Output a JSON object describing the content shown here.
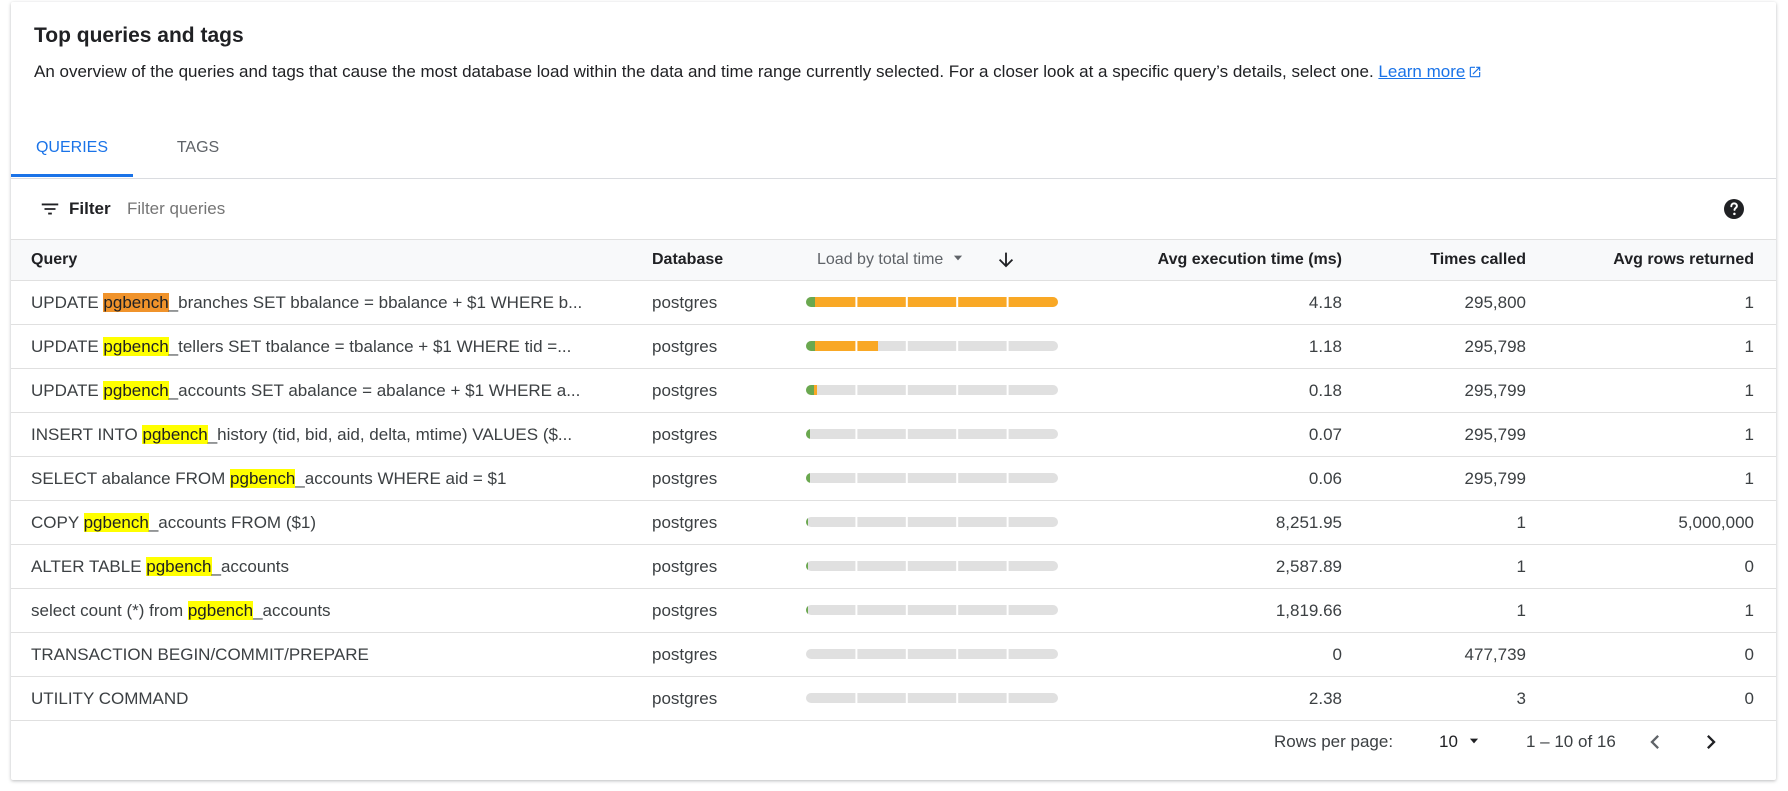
{
  "header": {
    "title": "Top queries and tags",
    "description": "An overview of the queries and tags that cause the most database load within the data and time range currently selected. For a closer look at a specific query’s details, select one.",
    "learn_more": "Learn more"
  },
  "tabs": [
    {
      "label": "QUERIES",
      "active": true
    },
    {
      "label": "TAGS",
      "active": false
    }
  ],
  "filter": {
    "label": "Filter",
    "placeholder": "Filter queries",
    "value": ""
  },
  "columns": {
    "query": "Query",
    "database": "Database",
    "load": "Load by total time",
    "avg_exec": "Avg execution time (ms)",
    "times_called": "Times called",
    "avg_rows": "Avg rows returned"
  },
  "colors": {
    "accent": "#1a73e8",
    "load_green": "#6aa84f",
    "load_orange": "#f9a825",
    "bar_track": "#e0e0e0",
    "highlight_yellow": "#ffff00",
    "highlight_orange": "#f0932b"
  },
  "rows": [
    {
      "pre": "UPDATE ",
      "hl": "pgbench",
      "post": "_branches SET bbalance = bbalance + $1 WHERE b...",
      "hl_style": "orange",
      "database": "postgres",
      "load_green": 0.035,
      "load_orange": 0.965,
      "avg_exec": "4.18",
      "times_called": "295,800",
      "avg_rows": "1"
    },
    {
      "pre": "UPDATE ",
      "hl": "pgbench",
      "post": "_tellers SET tbalance = tbalance + $1 WHERE tid =...",
      "hl_style": "yellow",
      "database": "postgres",
      "load_green": 0.035,
      "load_orange": 0.25,
      "avg_exec": "1.18",
      "times_called": "295,798",
      "avg_rows": "1"
    },
    {
      "pre": "UPDATE ",
      "hl": "pgbench",
      "post": "_accounts SET abalance = abalance + $1 WHERE a...",
      "hl_style": "yellow",
      "database": "postgres",
      "load_green": 0.03,
      "load_orange": 0.012,
      "avg_exec": "0.18",
      "times_called": "295,799",
      "avg_rows": "1"
    },
    {
      "pre": "INSERT INTO ",
      "hl": "pgbench",
      "post": "_history (tid, bid, aid, delta, mtime) VALUES ($...",
      "hl_style": "yellow",
      "database": "postgres",
      "load_green": 0.015,
      "load_orange": 0.0,
      "avg_exec": "0.07",
      "times_called": "295,799",
      "avg_rows": "1"
    },
    {
      "pre": "SELECT abalance FROM ",
      "hl": "pgbench",
      "post": "_accounts WHERE aid = $1",
      "hl_style": "yellow",
      "database": "postgres",
      "load_green": 0.015,
      "load_orange": 0.0,
      "avg_exec": "0.06",
      "times_called": "295,799",
      "avg_rows": "1"
    },
    {
      "pre": "COPY ",
      "hl": "pgbench",
      "post": "_accounts FROM ($1)",
      "hl_style": "yellow",
      "database": "postgres",
      "load_green": 0.006,
      "load_orange": 0.0,
      "avg_exec": "8,251.95",
      "times_called": "1",
      "avg_rows": "5,000,000"
    },
    {
      "pre": "ALTER TABLE ",
      "hl": "pgbench",
      "post": "_accounts",
      "hl_style": "yellow",
      "database": "postgres",
      "load_green": 0.006,
      "load_orange": 0.0,
      "avg_exec": "2,587.89",
      "times_called": "1",
      "avg_rows": "0"
    },
    {
      "pre": "select count (*) from ",
      "hl": "pgbench",
      "post": "_accounts",
      "hl_style": "yellow",
      "database": "postgres",
      "load_green": 0.006,
      "load_orange": 0.0,
      "avg_exec": "1,819.66",
      "times_called": "1",
      "avg_rows": "1"
    },
    {
      "pre": "TRANSACTION BEGIN/COMMIT/PREPARE",
      "hl": "",
      "post": "",
      "hl_style": "yellow",
      "database": "postgres",
      "load_green": 0.0,
      "load_orange": 0.0,
      "avg_exec": "0",
      "times_called": "477,739",
      "avg_rows": "0"
    },
    {
      "pre": "UTILITY COMMAND",
      "hl": "",
      "post": "",
      "hl_style": "yellow",
      "database": "postgres",
      "load_green": 0.0,
      "load_orange": 0.0,
      "avg_exec": "2.38",
      "times_called": "3",
      "avg_rows": "0"
    }
  ],
  "pagination": {
    "rows_per_page_label": "Rows per page:",
    "rows_per_page_value": "10",
    "range": "1 – 10 of 16"
  }
}
